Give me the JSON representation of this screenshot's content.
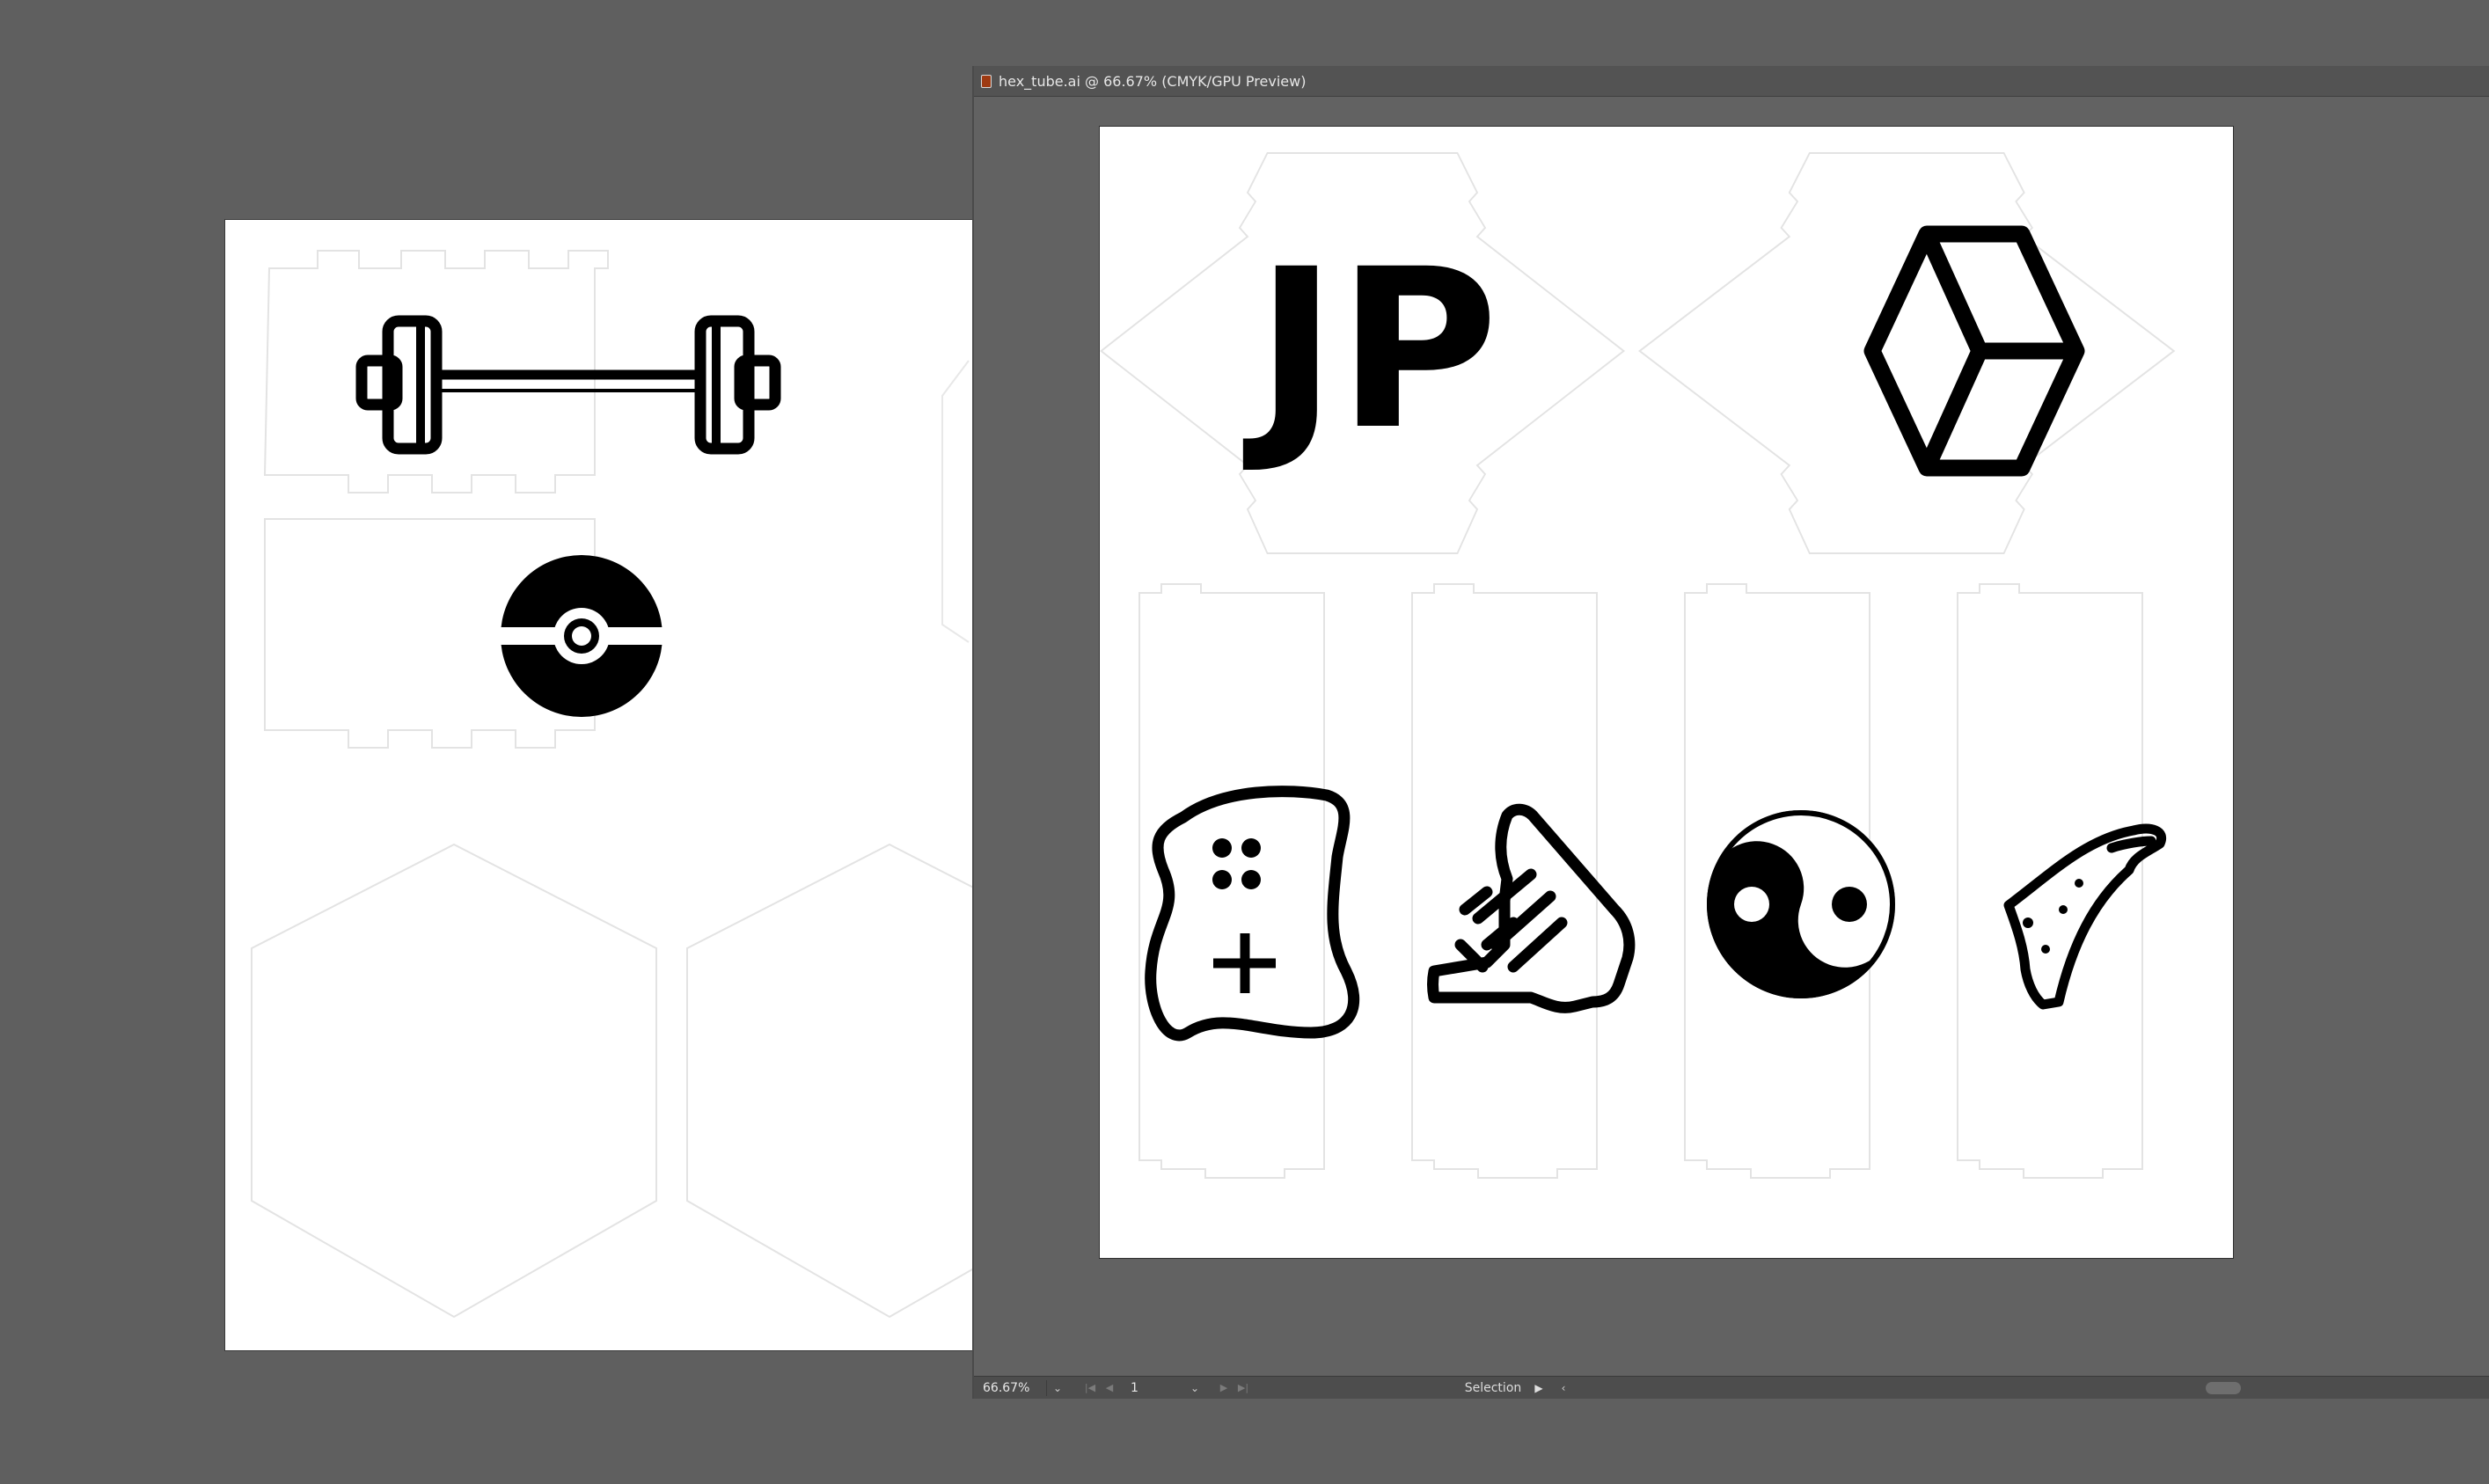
{
  "window": {
    "tab_title": "hex_tube.ai @ 66.67% (CMYK/GPU Preview)",
    "file_icon": "ai-file-icon"
  },
  "status_bar": {
    "zoom": "66.67%",
    "page": "1",
    "tool": "Selection",
    "dropdown_icon": "chevron-down-icon",
    "first_icon": "first-artboard-icon",
    "prev_icon": "previous-artboard-icon",
    "next_icon": "next-artboard-icon",
    "last_icon": "last-artboard-icon",
    "play_icon": "play-icon",
    "scroll_left_icon": "scroll-left-icon"
  },
  "artwork": {
    "monogram_text": "JP",
    "back_artboard_icons": [
      "barbell-icon",
      "pokeball-icon"
    ],
    "front_artboard_icons": [
      "cube-icon",
      "game-controller-icon",
      "shaka-hand-icon",
      "yin-yang-icon",
      "pizza-slice-icon"
    ]
  },
  "colors": {
    "canvas": "#5f5f5f",
    "artboard": "#ffffff",
    "art": "#000000",
    "cut_line": "#e3e3e3"
  }
}
